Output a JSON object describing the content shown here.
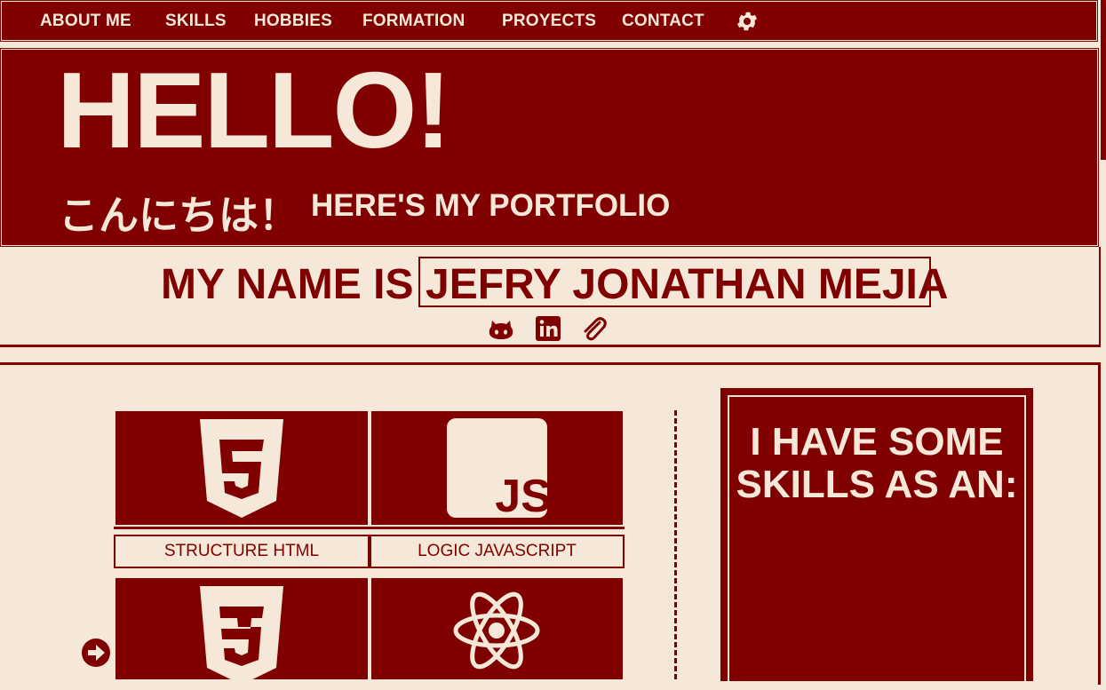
{
  "nav": {
    "items": [
      "ABOUT ME",
      "SKILLS",
      "HOBBIES",
      "FORMATION",
      "PROYECTS",
      "CONTACT"
    ],
    "settings_icon": "gear-icon"
  },
  "hero": {
    "hello": "HELLO!",
    "japanese": "こんにちは！",
    "subtitle": "HERE'S MY PORTFOLIO"
  },
  "intro": {
    "prefix": "MY NAME IS",
    "name": "JEFRY JONATHAN MEJIA",
    "social": [
      "github-icon",
      "linkedin-icon",
      "paperclip-icon"
    ]
  },
  "skills": {
    "tiles": [
      {
        "icon": "html5-icon",
        "label": "STRUCTURE HTML"
      },
      {
        "icon": "javascript-icon",
        "label": "LOGIC JAVASCRIPT"
      },
      {
        "icon": "css3-icon",
        "label": ""
      },
      {
        "icon": "react-icon",
        "label": ""
      }
    ],
    "heading": "I HAVE SOME SKILLS AS AN:",
    "next_icon": "arrow-right-icon"
  },
  "colors": {
    "primary": "#800000",
    "background": "#f5e8d8"
  }
}
